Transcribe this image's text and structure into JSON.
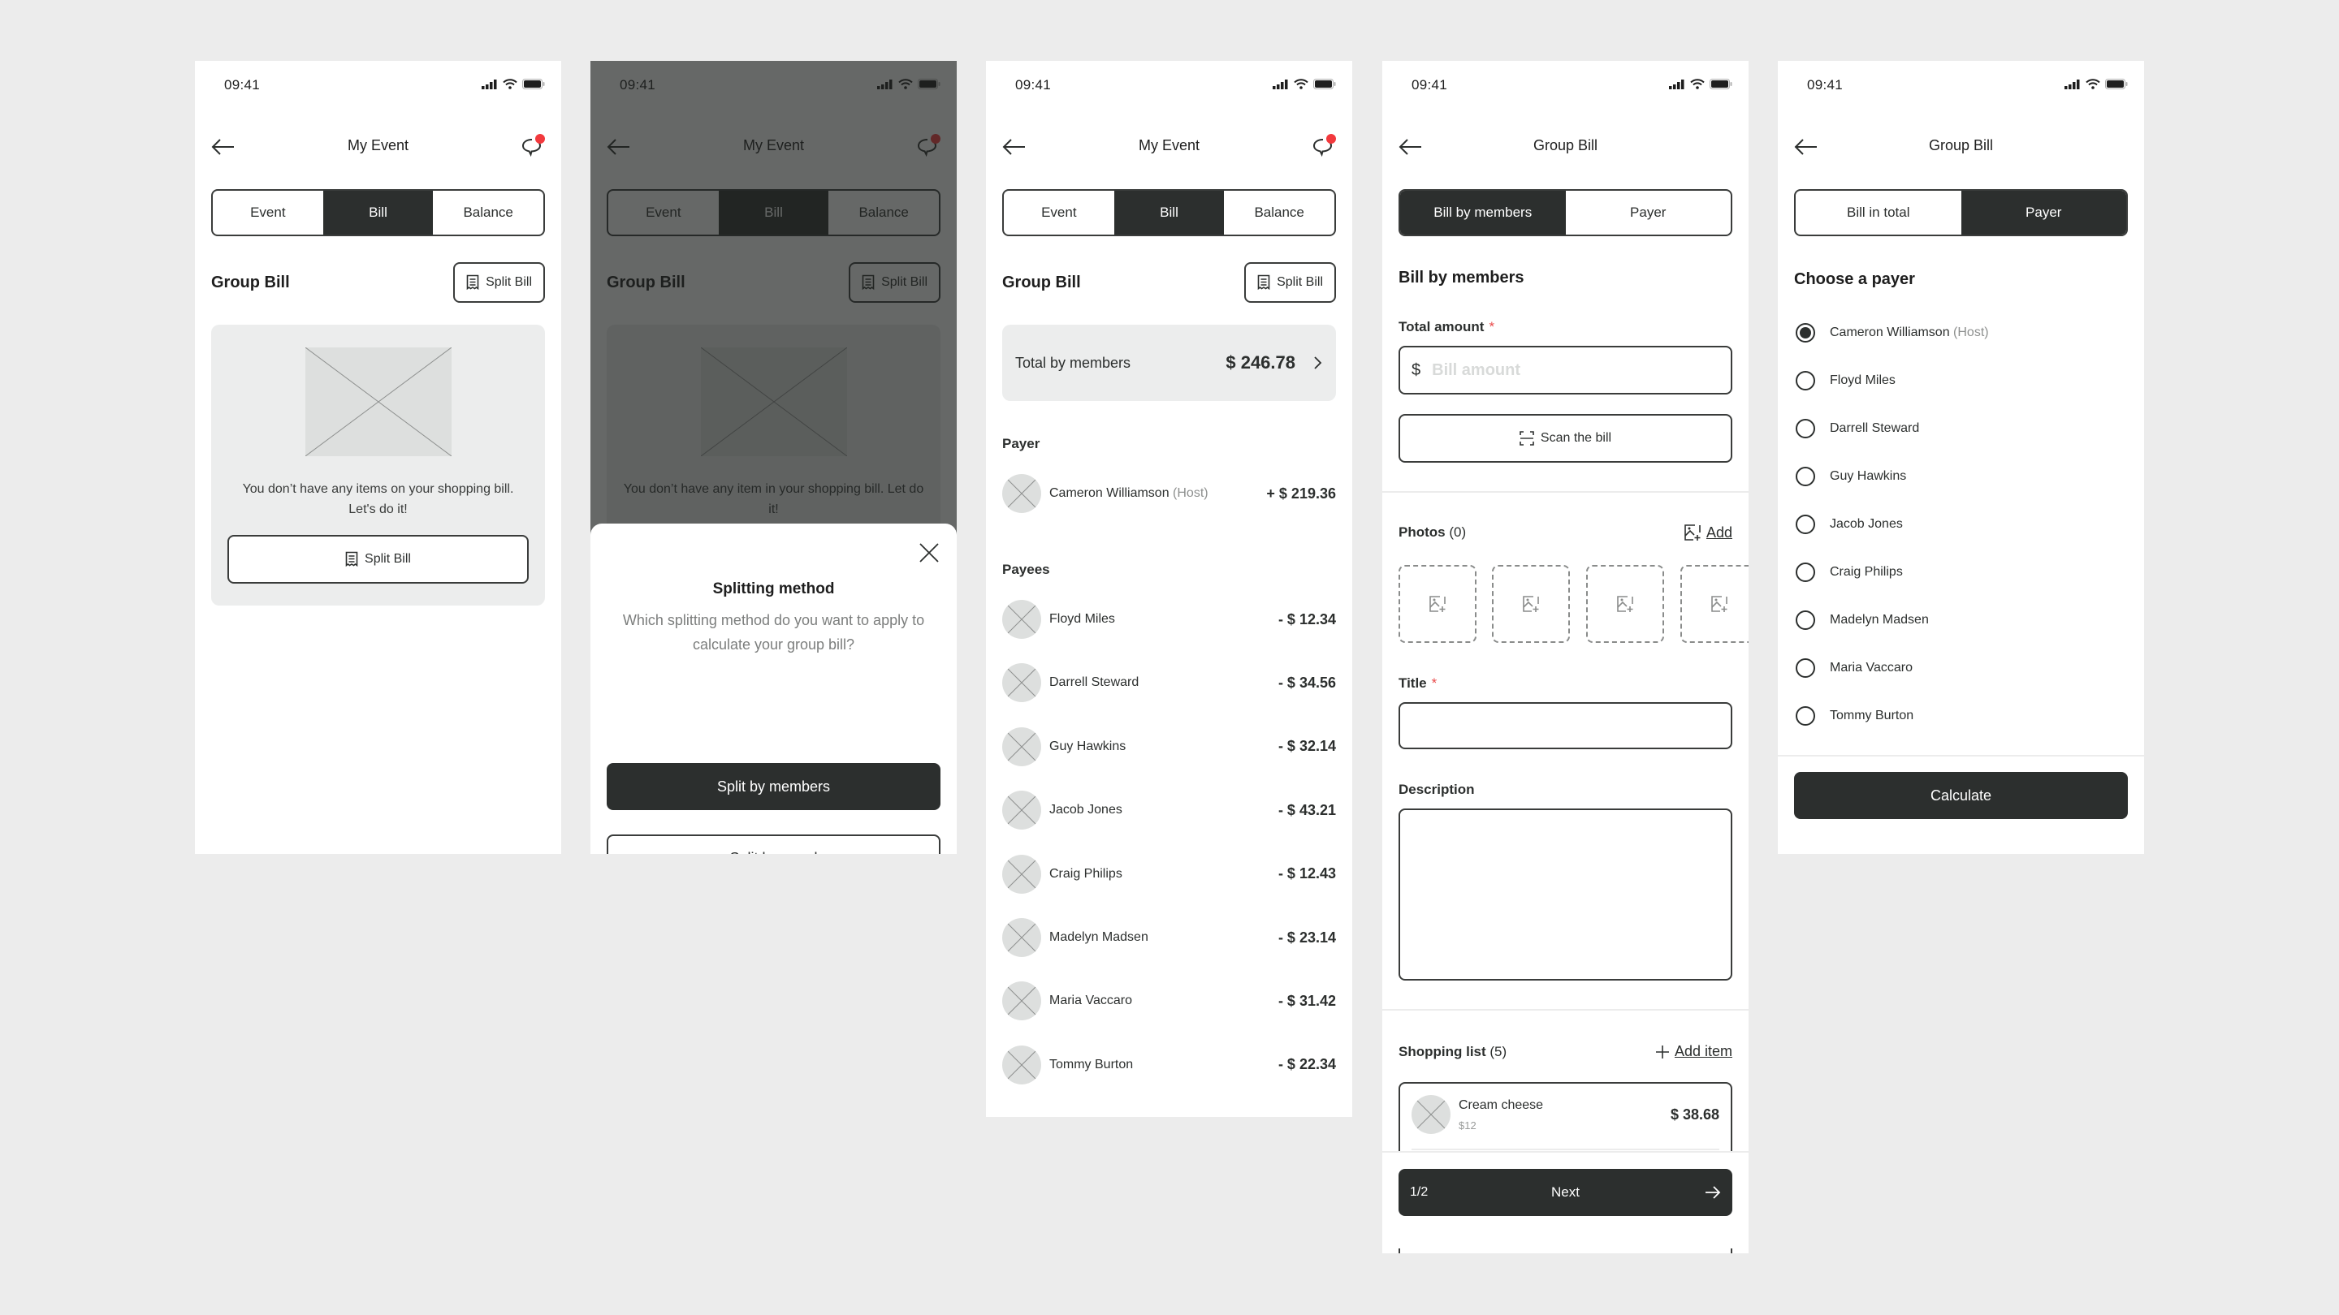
{
  "status_bar": {
    "time": "09:41"
  },
  "colors": {
    "primary": "#2c2f2e",
    "badge": "#f2393d",
    "required": "#e94b4b",
    "card": "#eceded",
    "canvas": "#ececec"
  },
  "screen1": {
    "nav_title": "My Event",
    "tabs": [
      {
        "label": "Event"
      },
      {
        "label": "Bill",
        "active": true
      },
      {
        "label": "Balance"
      }
    ],
    "section_title": "Group Bill",
    "split_bill_label": "Split Bill",
    "empty_text": "You don’t have any items on your shopping bill. Let's do it!",
    "empty_button_label": "Split Bill"
  },
  "screen2": {
    "nav_title": "My Event",
    "tabs": [
      {
        "label": "Event"
      },
      {
        "label": "Bill",
        "active": true
      },
      {
        "label": "Balance"
      }
    ],
    "section_title": "Group Bill",
    "split_bill_label": "Split Bill",
    "empty_text": "You don’t have any item in your shopping bill. Let do it!",
    "sheet": {
      "title": "Splitting method",
      "subtitle": "Which splitting method do you want to apply to calculate your group bill?",
      "primary_label": "Split by members",
      "secondary_label": "Split by equal"
    }
  },
  "screen3": {
    "nav_title": "My Event",
    "tabs": [
      {
        "label": "Event"
      },
      {
        "label": "Bill",
        "active": true
      },
      {
        "label": "Balance"
      }
    ],
    "section_title": "Group Bill",
    "split_bill_label": "Split Bill",
    "total_label": "Total by members",
    "total_value": "$ 246.78",
    "payer_heading": "Payer",
    "payer": {
      "name": "Cameron Williamson",
      "tag": "(Host)",
      "amount": "+ $ 219.36"
    },
    "payees_heading": "Payees",
    "payees": [
      {
        "name": "Floyd Miles",
        "amount": "- $ 12.34"
      },
      {
        "name": "Darrell Steward",
        "amount": "- $ 34.56"
      },
      {
        "name": "Guy Hawkins",
        "amount": "- $ 32.14"
      },
      {
        "name": "Jacob Jones",
        "amount": "- $ 43.21"
      },
      {
        "name": "Craig Philips",
        "amount": "- $ 12.43"
      },
      {
        "name": "Madelyn Madsen",
        "amount": "- $ 23.14"
      },
      {
        "name": "Maria Vaccaro",
        "amount": "- $ 31.42"
      },
      {
        "name": "Tommy Burton",
        "amount": "- $ 22.34"
      }
    ]
  },
  "screen4": {
    "nav_title": "Group Bill",
    "tabs": [
      {
        "label": "Bill by members",
        "active": true
      },
      {
        "label": "Payer"
      }
    ],
    "section_title": "Bill by members",
    "total_amount_label": "Total amount",
    "required_mark": "*",
    "currency_symbol": "$",
    "amount_placeholder": "Bill amount",
    "amount_value": "",
    "scan_label": "Scan the bill",
    "photos_label": "Photos",
    "photos_count": "(0)",
    "add_photo_label": "Add",
    "title_label": "Title",
    "title_value": "",
    "description_label": "Description",
    "description_value": "",
    "shopping_label": "Shopping list",
    "shopping_count": "(5)",
    "add_item_label": "Add item",
    "items": [
      {
        "name": "Cream cheese",
        "unit_price": "$12",
        "price": "$ 38.68"
      }
    ],
    "pager": "1/2",
    "next_label": "Next"
  },
  "screen5": {
    "nav_title": "Group Bill",
    "tabs": [
      {
        "label": "Bill in total"
      },
      {
        "label": "Payer",
        "active": true
      }
    ],
    "section_title": "Choose a payer",
    "payers": [
      {
        "name": "Cameron Williamson",
        "tag": "(Host)",
        "selected": true
      },
      {
        "name": "Floyd Miles"
      },
      {
        "name": "Darrell Steward"
      },
      {
        "name": "Guy Hawkins"
      },
      {
        "name": "Jacob Jones"
      },
      {
        "name": "Craig Philips"
      },
      {
        "name": "Madelyn Madsen"
      },
      {
        "name": "Maria Vaccaro"
      },
      {
        "name": "Tommy Burton"
      }
    ],
    "calculate_label": "Calculate"
  }
}
